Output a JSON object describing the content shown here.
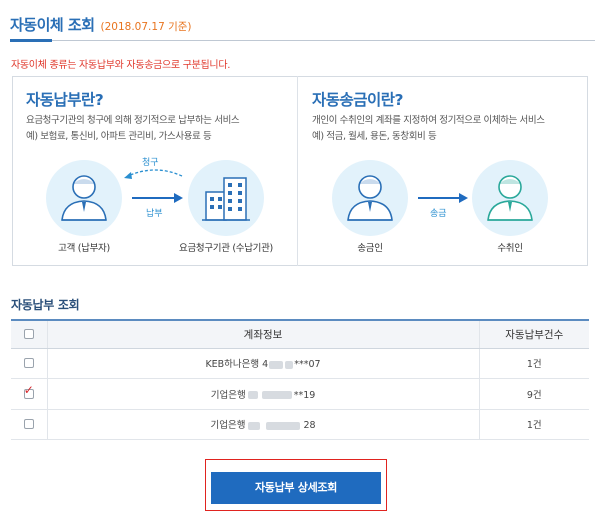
{
  "header": {
    "title": "자동이체 조회",
    "date_note": "(2018.07.17 기준)"
  },
  "notice": "자동이체 종류는 자동납부와 자동송금으로 구분됩니다.",
  "auto_pay_panel": {
    "title": "자동납부란?",
    "desc_line1": "요금청구기관의 청구에 의해 정기적으로 납부하는 서비스",
    "desc_line2": "예) 보험료, 통신비, 아파트 관리비, 가스사용료 등",
    "customer_label": "고객 (납부자)",
    "institution_label": "요금청구기관 (수납기관)",
    "arrow_pay_label": "납부",
    "arrow_bill_label": "청구"
  },
  "auto_transfer_panel": {
    "title": "자동송금이란?",
    "desc_line1": "개인이 수취인의 계좌를 지정하여 정기적으로 이체하는 서비스",
    "desc_line2": "예) 적금, 월세, 용돈, 동창회비 등",
    "sender_label": "송금인",
    "receiver_label": "수취인",
    "arrow_label": "송금"
  },
  "lookup": {
    "section_title": "자동납부 조회",
    "columns": [
      "계좌정보",
      "자동납부건수"
    ],
    "rows": [
      {
        "account_prefix": "KEB하나은행 4",
        "account_suffix": "***07",
        "count": "1건",
        "checked": false
      },
      {
        "account_prefix": "기업은행",
        "account_suffix": "**19",
        "count": "9건",
        "checked": true
      },
      {
        "account_prefix": "기업은행",
        "account_suffix": "28",
        "count": "1건",
        "checked": false
      }
    ]
  },
  "detail_button_label": "자동납부 상세조회",
  "colors": {
    "accent_blue": "#2a6fb6",
    "button_blue": "#1f6bbf",
    "notice_red": "#e03a2e",
    "date_orange": "#e8741f",
    "circle_bg": "#e2f2fb",
    "highlight_red": "#e0231f"
  }
}
